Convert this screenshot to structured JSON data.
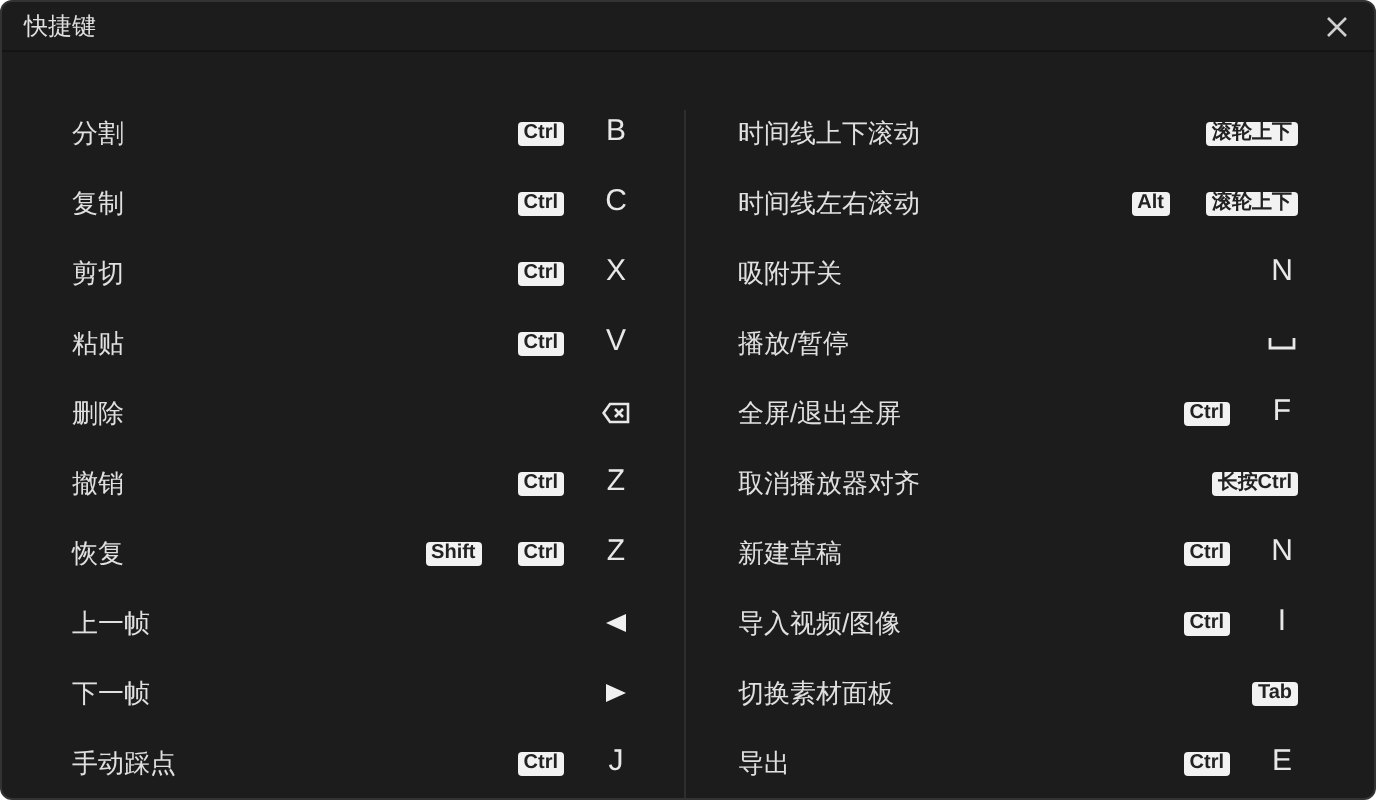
{
  "window": {
    "title": "快捷键"
  },
  "columns": [
    {
      "rows": [
        {
          "label": "分割",
          "badges": [
            "Ctrl"
          ],
          "key": {
            "kind": "letter",
            "text": "B"
          }
        },
        {
          "label": "复制",
          "badges": [
            "Ctrl"
          ],
          "key": {
            "kind": "letter",
            "text": "C"
          }
        },
        {
          "label": "剪切",
          "badges": [
            "Ctrl"
          ],
          "key": {
            "kind": "letter",
            "text": "X"
          }
        },
        {
          "label": "粘贴",
          "badges": [
            "Ctrl"
          ],
          "key": {
            "kind": "letter",
            "text": "V"
          }
        },
        {
          "label": "删除",
          "badges": [],
          "key": {
            "kind": "backspace"
          }
        },
        {
          "label": "撤销",
          "badges": [
            "Ctrl"
          ],
          "key": {
            "kind": "letter",
            "text": "Z"
          }
        },
        {
          "label": "恢复",
          "badges": [
            "Shift",
            "Ctrl"
          ],
          "key": {
            "kind": "letter",
            "text": "Z"
          }
        },
        {
          "label": "上一帧",
          "badges": [],
          "key": {
            "kind": "prev"
          }
        },
        {
          "label": "下一帧",
          "badges": [],
          "key": {
            "kind": "next"
          }
        },
        {
          "label": "手动踩点",
          "badges": [
            "Ctrl"
          ],
          "key": {
            "kind": "letter",
            "text": "J"
          }
        }
      ]
    },
    {
      "rows": [
        {
          "label": "时间线上下滚动",
          "badges": [
            "滚轮上下"
          ]
        },
        {
          "label": "时间线左右滚动",
          "badges": [
            "Alt",
            "滚轮上下"
          ]
        },
        {
          "label": "吸附开关",
          "badges": [],
          "key": {
            "kind": "letter",
            "text": "N"
          }
        },
        {
          "label": "播放/暂停",
          "badges": [],
          "key": {
            "kind": "space"
          }
        },
        {
          "label": "全屏/退出全屏",
          "badges": [
            "Ctrl"
          ],
          "key": {
            "kind": "letter",
            "text": "F"
          }
        },
        {
          "label": "取消播放器对齐",
          "badges": [
            "长按Ctrl"
          ]
        },
        {
          "label": "新建草稿",
          "badges": [
            "Ctrl"
          ],
          "key": {
            "kind": "letter",
            "text": "N"
          }
        },
        {
          "label": "导入视频/图像",
          "badges": [
            "Ctrl"
          ],
          "key": {
            "kind": "letter",
            "text": "I"
          }
        },
        {
          "label": "切换素材面板",
          "badges": [
            "Tab"
          ]
        },
        {
          "label": "导出",
          "badges": [
            "Ctrl"
          ],
          "key": {
            "kind": "letter",
            "text": "E"
          }
        }
      ]
    }
  ]
}
